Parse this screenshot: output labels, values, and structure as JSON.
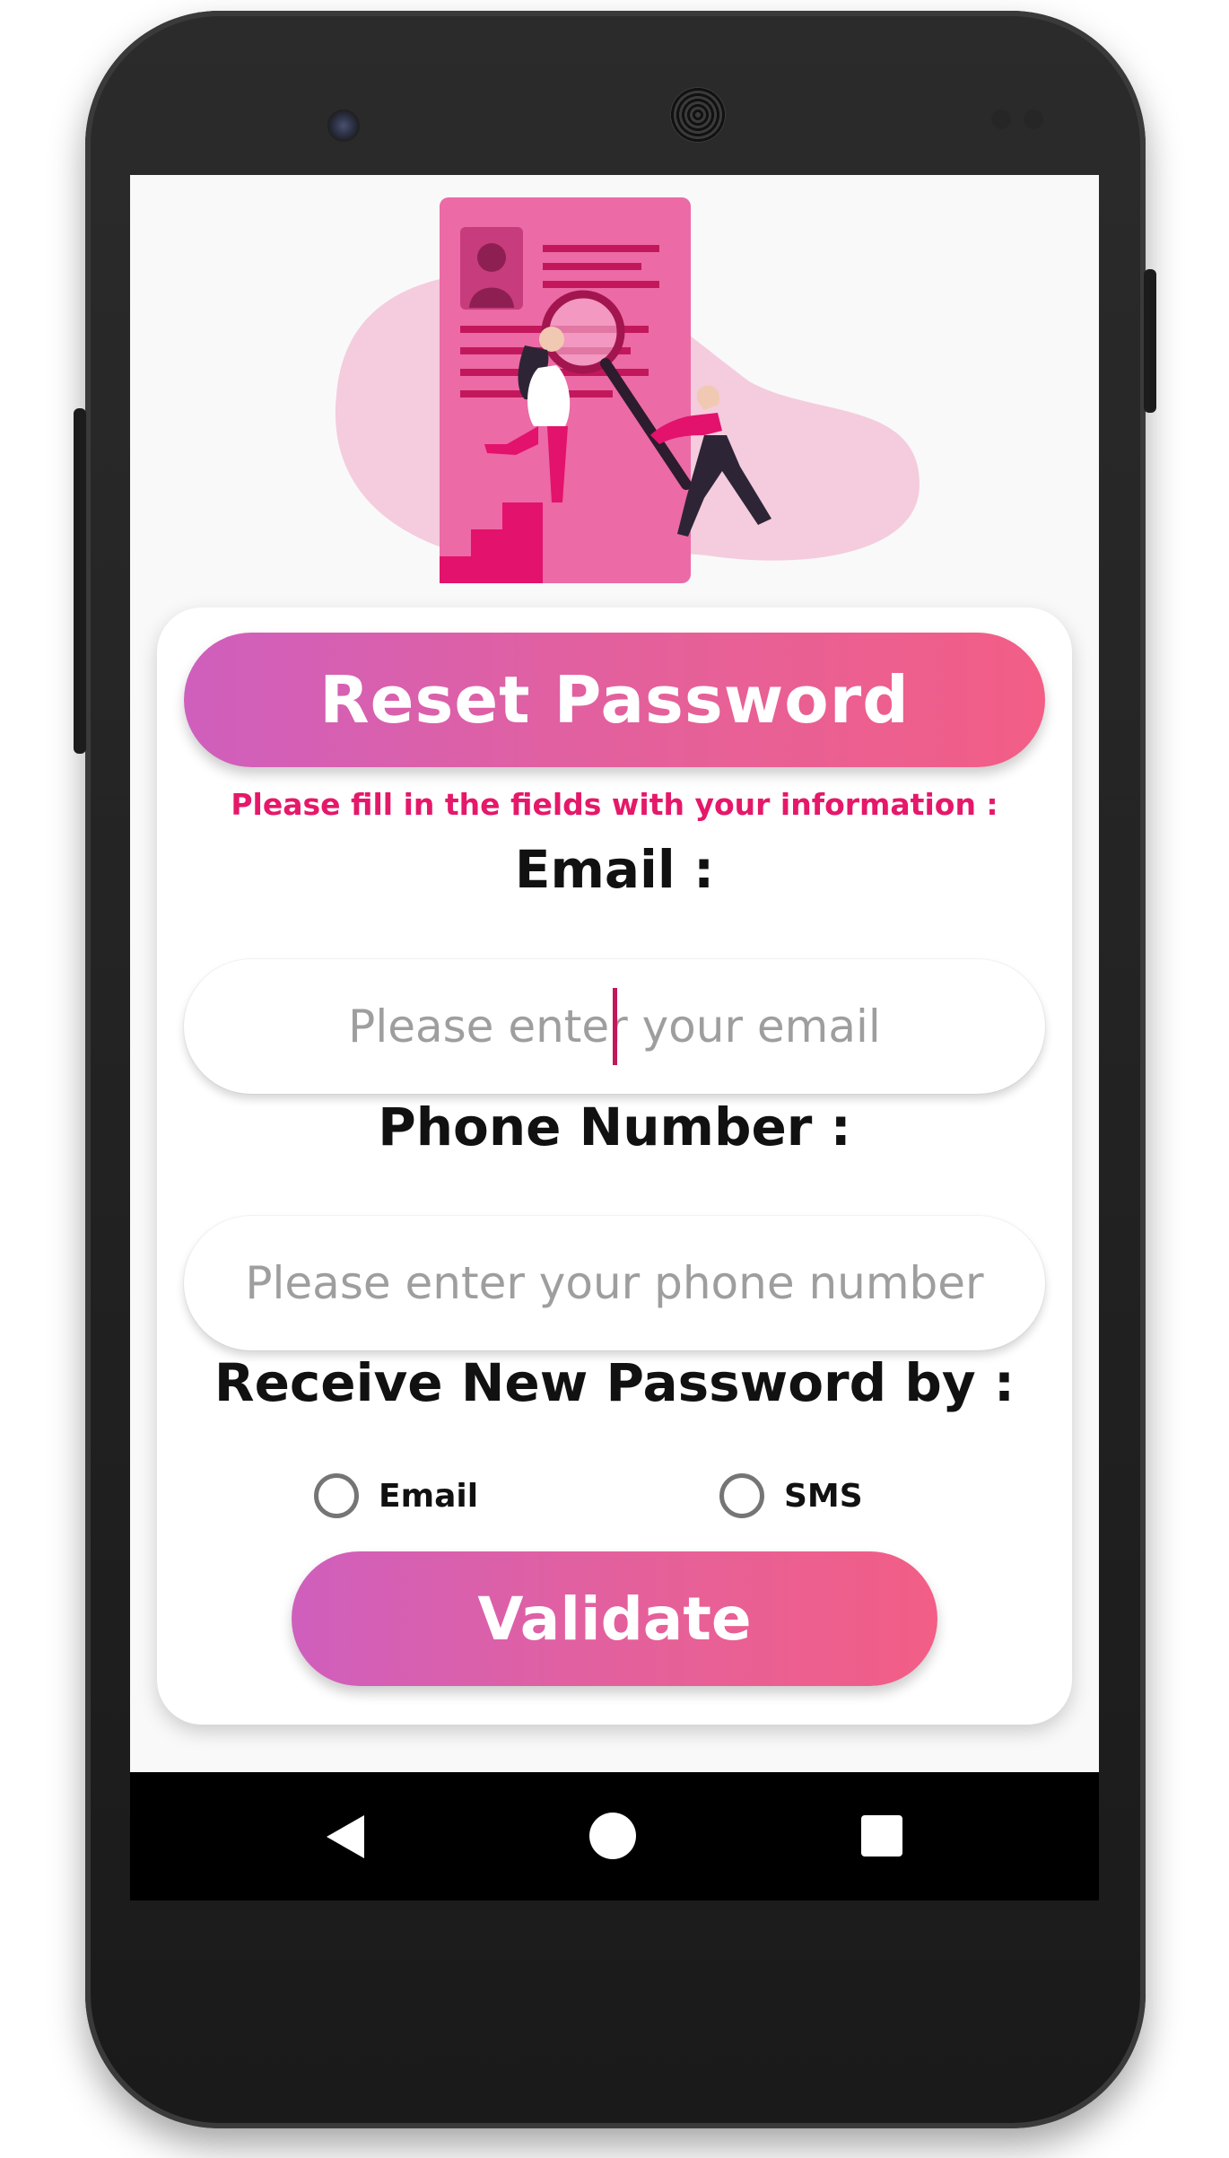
{
  "header": {
    "title": "Reset Password"
  },
  "form": {
    "hint": "Please fill in the fields with your information :",
    "email_label": "Email :",
    "email_placeholder": "Please enter your email",
    "email_value": "",
    "phone_label": "Phone Number :",
    "phone_placeholder": "Please enter your phone number",
    "phone_value": "",
    "receive_label": "Receive New Password by :",
    "options": [
      {
        "label": "Email",
        "selected": false
      },
      {
        "label": "SMS",
        "selected": false
      }
    ],
    "validate_label": "Validate"
  },
  "nav": {
    "icons": [
      "back-icon",
      "home-icon",
      "recent-apps-icon"
    ]
  },
  "colors": {
    "accent_start": "#cf5fbd",
    "accent_end": "#f25e86",
    "hint_text": "#e5186a",
    "illustration_pink": "#e8639c"
  }
}
